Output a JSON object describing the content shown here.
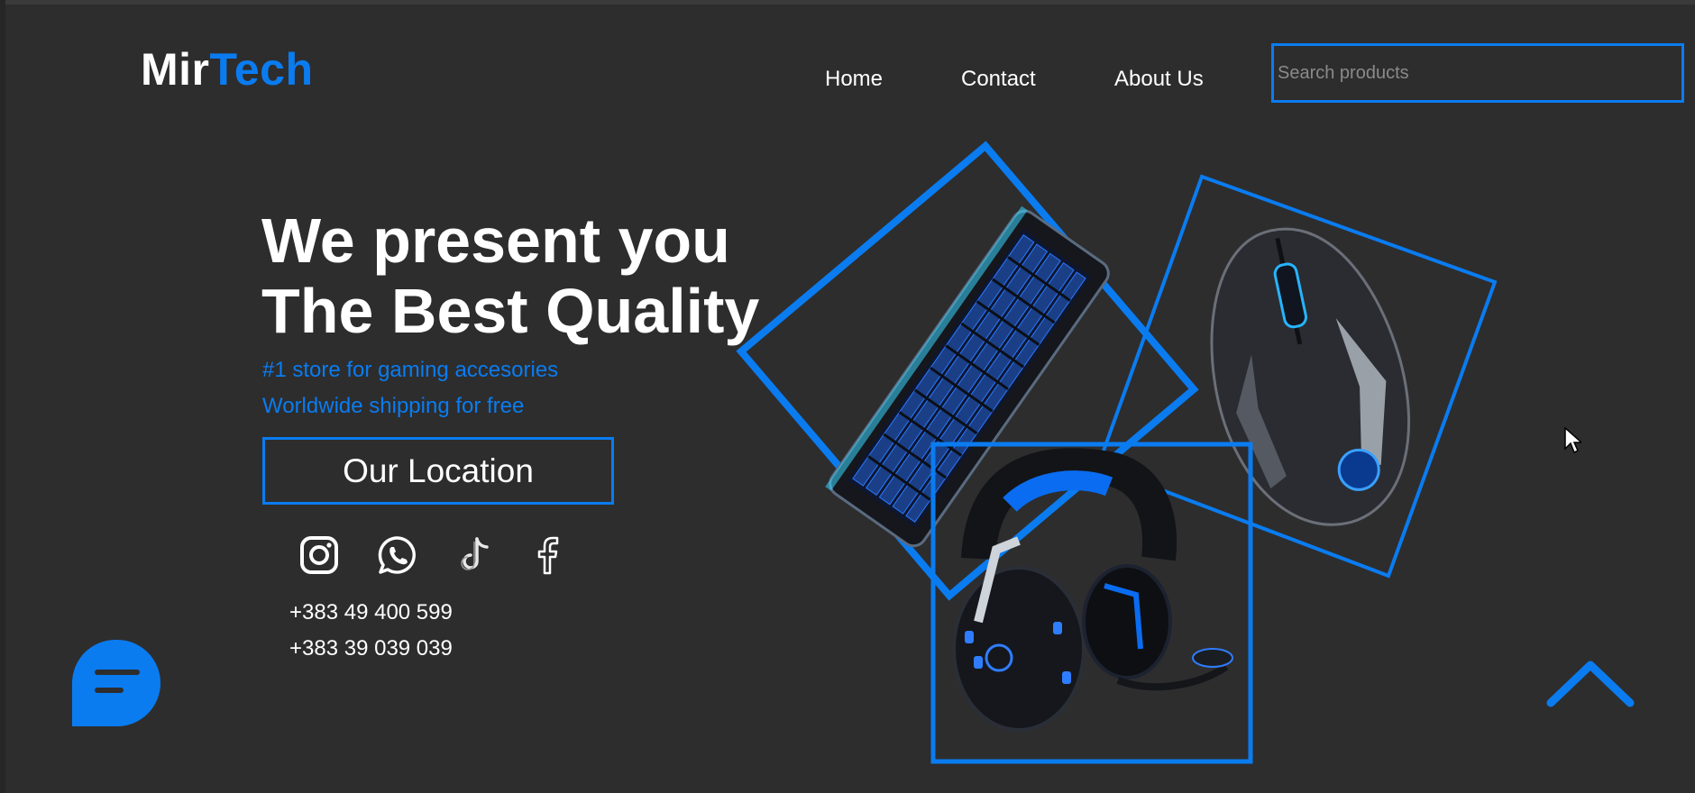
{
  "logo": {
    "part1": "Mir",
    "part2": "Tech"
  },
  "nav": {
    "home": "Home",
    "contact": "Contact",
    "about": "About Us"
  },
  "search": {
    "placeholder": "Search products",
    "value": ""
  },
  "hero": {
    "title_line1": "We present you",
    "title_line2": "The Best Quality",
    "tagline1": "#1 store for gaming accesories",
    "tagline2": "Worldwide shipping for free",
    "location_button": "Our Location"
  },
  "social": [
    "instagram-icon",
    "whatsapp-icon",
    "tiktok-icon",
    "facebook-icon"
  ],
  "phones": [
    "+383 49 400 599",
    "+383 39 039 039"
  ],
  "products": [
    "keyboard",
    "mouse",
    "headset"
  ],
  "colors": {
    "accent": "#0a7cf0",
    "background": "#2d2d2e",
    "text": "#ffffff"
  }
}
